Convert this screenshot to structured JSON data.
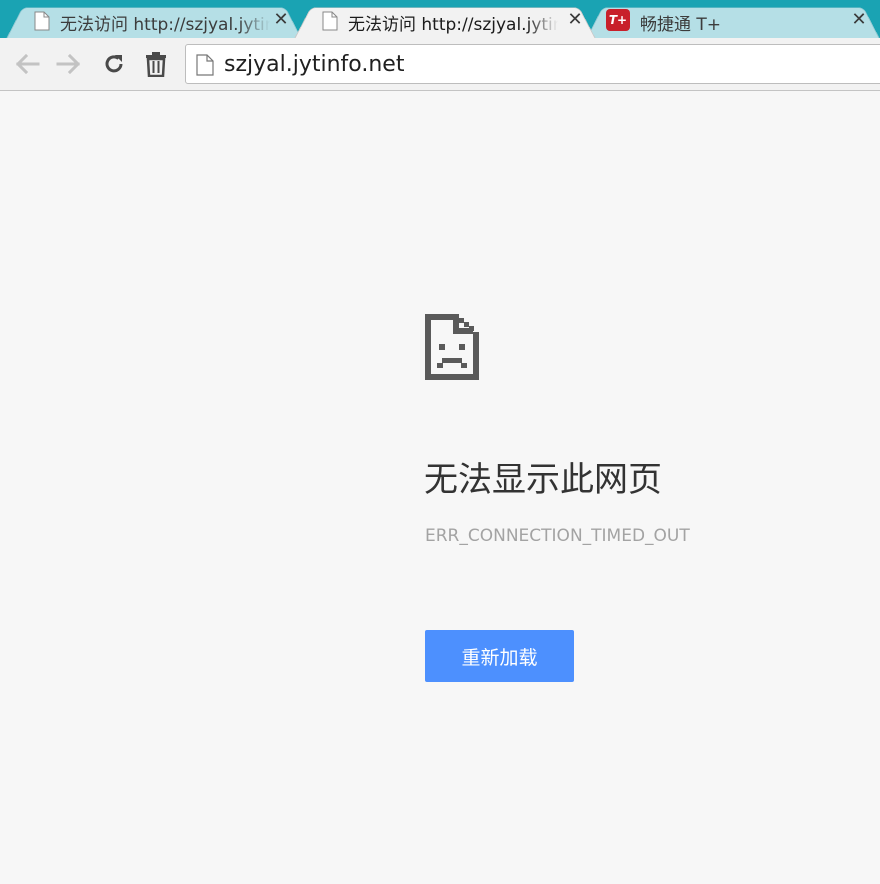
{
  "tabs": [
    {
      "title": "无法访问 http://szjyal.jytinfo.net",
      "active": false,
      "icon": "page-icon"
    },
    {
      "title": "无法访问 http://szjyal.jytinfo.net",
      "active": true,
      "icon": "page-icon"
    },
    {
      "title": "畅捷通 T+",
      "active": false,
      "icon": "tplus-icon",
      "icon_text": "T+"
    }
  ],
  "tab_close_glyph": "✕",
  "toolbar": {
    "url": "szjyal.jytinfo.net",
    "buttons": [
      "back-arrow-icon",
      "forward-arrow-icon",
      "reload-icon",
      "trash-icon"
    ]
  },
  "error_page": {
    "title": "无法显示此网页",
    "code": "ERR_CONNECTION_TIMED_OUT",
    "reload_label": "重新加载"
  },
  "colors": {
    "tabstrip": "#1aa3b3",
    "inactive_tab": "#b5dfe6",
    "button": "#4d90fe",
    "tplus_icon": "#c8202a"
  }
}
